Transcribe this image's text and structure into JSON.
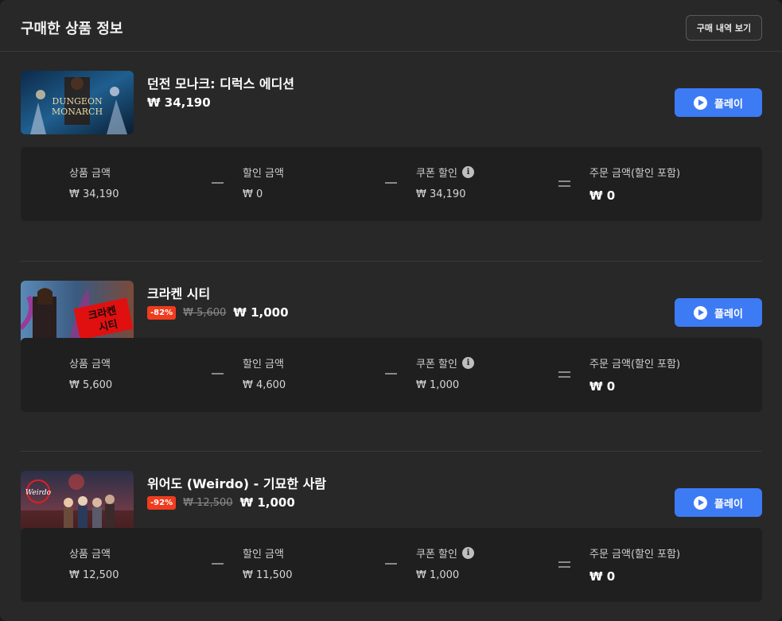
{
  "header": {
    "title": "구매한 상품 정보",
    "history_button": "구매 내역 보기"
  },
  "labels": {
    "product_amount": "상품 금액",
    "discount_amount": "할인 금액",
    "coupon_discount": "쿠폰 할인",
    "order_amount": "주문 금액(할인 포함)",
    "play": "플레이"
  },
  "products": [
    {
      "name": "던전 모나크: 디럭스 에디션",
      "badge": "",
      "original_price": "",
      "price": "₩ 34,190",
      "summary": {
        "product_amount": "₩ 34,190",
        "discount_amount": "₩ 0",
        "coupon_discount": "₩ 34,190",
        "order_amount": "₩ 0"
      },
      "thumb_text": [
        "DUNGEON",
        "MONARCH"
      ]
    },
    {
      "name": "크라켄 시티",
      "badge": "-82%",
      "original_price": "₩ 5,600",
      "price": "₩ 1,000",
      "summary": {
        "product_amount": "₩ 5,600",
        "discount_amount": "₩ 4,600",
        "coupon_discount": "₩ 1,000",
        "order_amount": "₩ 0"
      },
      "thumb_text": [
        "크라켄",
        "시티"
      ]
    },
    {
      "name": "위어도 (Weirdo) - 기묘한 사람",
      "badge": "-92%",
      "original_price": "₩ 12,500",
      "price": "₩ 1,000",
      "summary": {
        "product_amount": "₩ 12,500",
        "discount_amount": "₩ 11,500",
        "coupon_discount": "₩ 1,000",
        "order_amount": "₩ 0"
      },
      "thumb_text": [
        "Weirdo"
      ]
    }
  ],
  "colors": {
    "accent": "#3d7bf5",
    "badge": "#f03c1e"
  }
}
